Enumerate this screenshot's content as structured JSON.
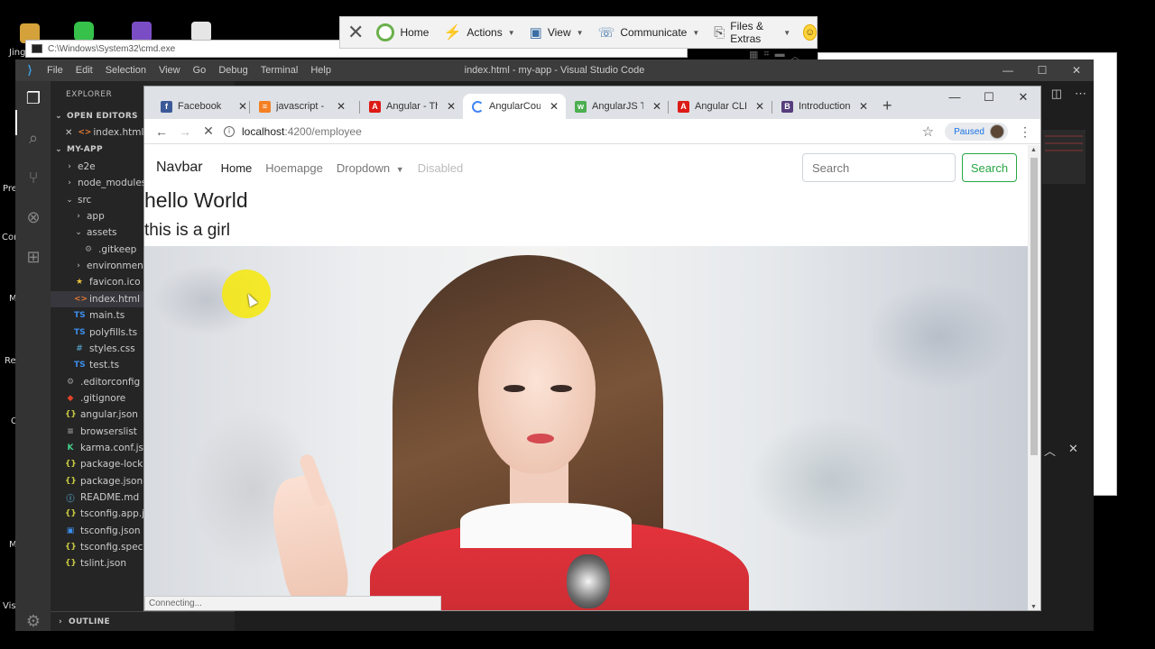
{
  "desktop": {
    "labels": [
      "Jing",
      "Pre",
      "Con",
      "M",
      "Re",
      "C",
      "M",
      "Vis"
    ]
  },
  "remote_toolbar": {
    "items": [
      {
        "label": "Home",
        "icon": "home-icon"
      },
      {
        "label": "Actions",
        "icon": "lightning-icon"
      },
      {
        "label": "View",
        "icon": "monitor-icon"
      },
      {
        "label": "Communicate",
        "icon": "phone-icon"
      },
      {
        "label": "Files & Extras",
        "icon": "file-transfer-icon"
      }
    ]
  },
  "cmd": {
    "title": "C:\\Windows\\System32\\cmd.exe"
  },
  "vscode": {
    "menu": [
      "File",
      "Edit",
      "Selection",
      "View",
      "Go",
      "Debug",
      "Terminal",
      "Help"
    ],
    "window_title": "index.html - my-app - Visual Studio Code",
    "explorer_title": "EXPLORER",
    "open_editors_label": "OPEN EDITORS",
    "open_editor_file": "index.html",
    "project_label": "MY-APP",
    "tree": [
      {
        "name": "e2e",
        "type": "folder",
        "expanded": false,
        "level": 1
      },
      {
        "name": "node_modules",
        "type": "folder",
        "expanded": false,
        "level": 1
      },
      {
        "name": "src",
        "type": "folder",
        "expanded": true,
        "level": 1
      },
      {
        "name": "app",
        "type": "folder",
        "expanded": false,
        "level": 2
      },
      {
        "name": "assets",
        "type": "folder",
        "expanded": true,
        "level": 2
      },
      {
        "name": ".gitkeep",
        "type": "file",
        "icon": "gear",
        "level": 3
      },
      {
        "name": "environments",
        "type": "folder",
        "expanded": false,
        "level": 2
      },
      {
        "name": "favicon.ico",
        "type": "file",
        "icon": "star",
        "level": 2
      },
      {
        "name": "index.html",
        "type": "file",
        "icon": "html",
        "level": 2,
        "selected": true
      },
      {
        "name": "main.ts",
        "type": "file",
        "icon": "ts",
        "level": 2
      },
      {
        "name": "polyfills.ts",
        "type": "file",
        "icon": "ts",
        "level": 2
      },
      {
        "name": "styles.css",
        "type": "file",
        "icon": "css",
        "level": 2
      },
      {
        "name": "test.ts",
        "type": "file",
        "icon": "ts",
        "level": 2
      },
      {
        "name": ".editorconfig",
        "type": "file",
        "icon": "gear",
        "level": 1
      },
      {
        "name": ".gitignore",
        "type": "file",
        "icon": "git",
        "level": 1
      },
      {
        "name": "angular.json",
        "type": "file",
        "icon": "json",
        "level": 1
      },
      {
        "name": "browserslist",
        "type": "file",
        "icon": "text",
        "level": 1
      },
      {
        "name": "karma.conf.js",
        "type": "file",
        "icon": "karma",
        "level": 1
      },
      {
        "name": "package-lock.json",
        "type": "file",
        "icon": "json",
        "level": 1
      },
      {
        "name": "package.json",
        "type": "file",
        "icon": "json",
        "level": 1
      },
      {
        "name": "README.md",
        "type": "file",
        "icon": "info",
        "level": 1
      },
      {
        "name": "tsconfig.app.json",
        "type": "file",
        "icon": "json",
        "level": 1
      },
      {
        "name": "tsconfig.json",
        "type": "file",
        "icon": "tsconfig",
        "level": 1
      },
      {
        "name": "tsconfig.spec.json",
        "type": "file",
        "icon": "json",
        "level": 1
      },
      {
        "name": "tslint.json",
        "type": "file",
        "icon": "json",
        "level": 1
      }
    ],
    "outline_label": "OUTLINE"
  },
  "chrome": {
    "tabs": [
      {
        "title": "Facebook",
        "icon": "facebook-icon",
        "color": "#3b5998",
        "glyph": "f"
      },
      {
        "title": "javascript - Hi",
        "icon": "stackoverflow-icon",
        "color": "#f48024",
        "glyph": "≡"
      },
      {
        "title": "Angular - The",
        "icon": "angular-icon",
        "color": "#dd1b16",
        "glyph": "A"
      },
      {
        "title": "AngularCours",
        "icon": "loading-spinner-icon",
        "color": "#4285f4",
        "glyph": "",
        "active": true
      },
      {
        "title": "AngularJS Tut",
        "icon": "w3schools-icon",
        "color": "#4caf50",
        "glyph": "w"
      },
      {
        "title": "Angular CLI",
        "icon": "angular-icon",
        "color": "#dd1b16",
        "glyph": "A"
      },
      {
        "title": "Introduction",
        "icon": "bootstrap-icon",
        "color": "#563d7c",
        "glyph": "B"
      }
    ],
    "url_host": "localhost",
    "url_path": ":4200/employee",
    "profile_status": "Paused",
    "status_text": "Connecting..."
  },
  "page": {
    "brand": "Navbar",
    "nav": [
      {
        "label": "Home",
        "state": "active"
      },
      {
        "label": "Hoemapge",
        "state": "normal"
      },
      {
        "label": "Dropdown",
        "state": "dropdown"
      },
      {
        "label": "Disabled",
        "state": "disabled"
      }
    ],
    "search_placeholder": "Search",
    "search_button": "Search",
    "heading": "hello World",
    "subheading": "this is a girl"
  },
  "colors": {
    "vscode_bg": "#1e1e1e",
    "vscode_sidebar": "#252526",
    "chrome_tabstrip": "#dee1e6",
    "success": "#28a745"
  }
}
